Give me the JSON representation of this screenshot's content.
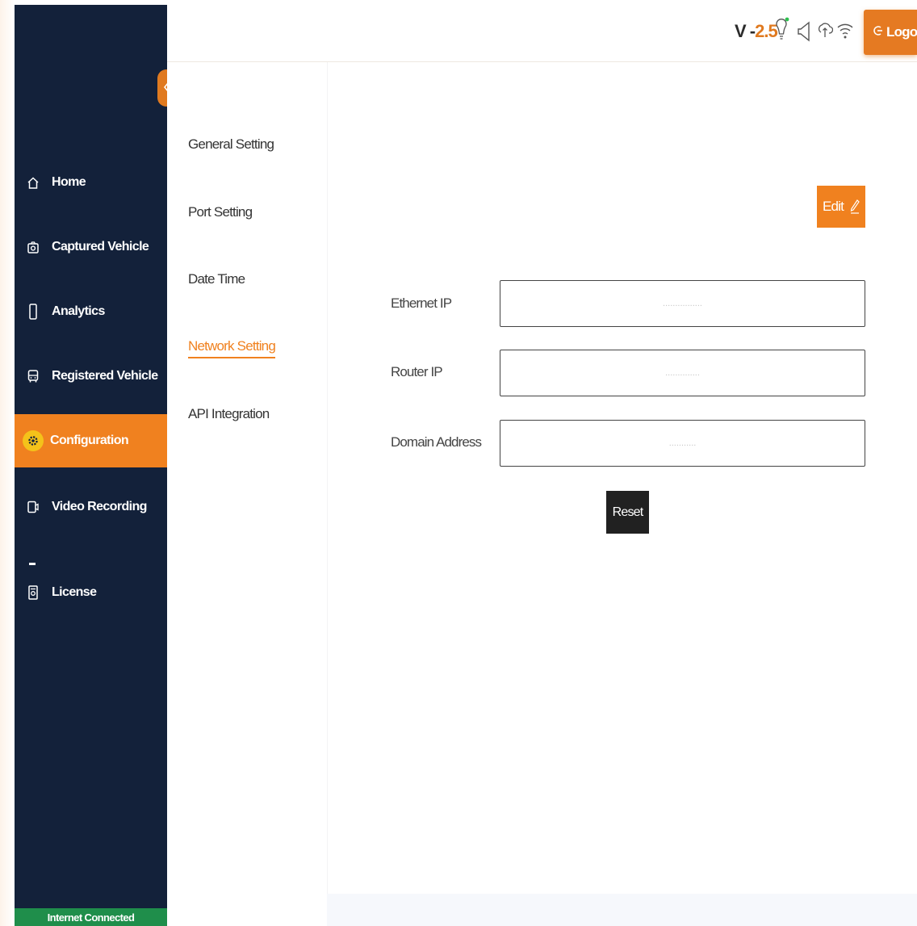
{
  "header": {
    "version_prefix": "V -",
    "version_number": "2.5",
    "logout_label": "Logout",
    "icons": [
      "bulb-icon",
      "speaker-icon",
      "upload-icon",
      "wifi-icon"
    ]
  },
  "sidebar": {
    "items": [
      {
        "label": "Home",
        "icon": "home-icon"
      },
      {
        "label": "Captured Vehicle",
        "icon": "camera-icon"
      },
      {
        "label": "Analytics",
        "icon": "analytics-icon"
      },
      {
        "label": "Registered Vehicle",
        "icon": "bus-icon"
      },
      {
        "label": "Configuration",
        "icon": "gear-icon",
        "active": true
      },
      {
        "label": "Video Recording",
        "icon": "video-icon"
      },
      {
        "label": "License",
        "icon": "license-icon"
      }
    ],
    "status": "Internet Connected"
  },
  "settings_nav": {
    "items": [
      {
        "label": "General Setting"
      },
      {
        "label": "Port Setting"
      },
      {
        "label": "Date Time"
      },
      {
        "label": "Network Setting",
        "active": true
      },
      {
        "label": "API Integration"
      }
    ]
  },
  "form": {
    "edit_label": "Edit",
    "ethernet_label": "Ethernet IP",
    "ethernet_placeholder": "................",
    "router_label": "Router IP",
    "router_placeholder": "..............",
    "domain_label": "Domain Address",
    "domain_placeholder": "...........",
    "reset_label": "Reset"
  },
  "colors": {
    "accent": "#f0811f",
    "sidebar_bg": "#13213a",
    "status_green": "#1f8e4b",
    "active_icon_bg": "#f4c21a",
    "reset_bg": "#212121"
  }
}
